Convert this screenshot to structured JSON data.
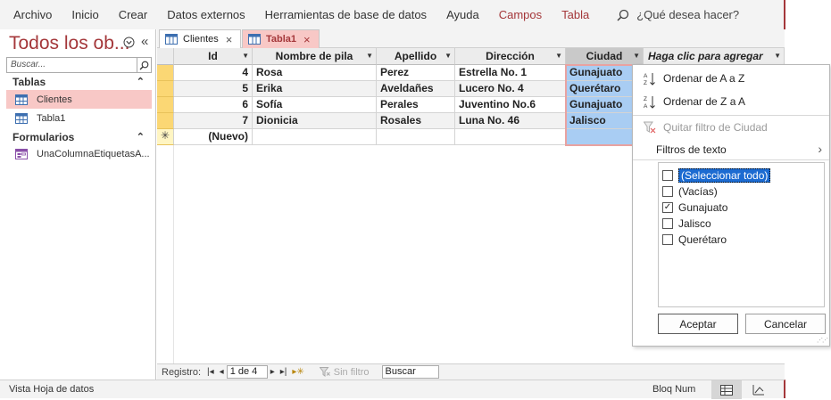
{
  "ribbon": {
    "tabs": [
      {
        "label": "Archivo",
        "contextual": false
      },
      {
        "label": "Inicio",
        "contextual": false
      },
      {
        "label": "Crear",
        "contextual": false
      },
      {
        "label": "Datos externos",
        "contextual": false
      },
      {
        "label": "Herramientas de base de datos",
        "contextual": false
      },
      {
        "label": "Ayuda",
        "contextual": false
      },
      {
        "label": "Campos",
        "contextual": true
      },
      {
        "label": "Tabla",
        "contextual": true
      }
    ],
    "tell_me": "¿Qué desea hacer?"
  },
  "nav": {
    "title": "Todos los ob...",
    "search_placeholder": "Buscar...",
    "groups": [
      {
        "label": "Tablas",
        "items": [
          {
            "label": "Clientes",
            "selected": true,
            "icon": "table-icon"
          },
          {
            "label": "Tabla1",
            "selected": false,
            "icon": "table-icon"
          }
        ]
      },
      {
        "label": "Formularios",
        "items": [
          {
            "label": "UnaColumnaEtiquetasA...",
            "selected": false,
            "icon": "form-icon"
          }
        ]
      }
    ]
  },
  "doc_tabs": [
    {
      "label": "Clientes",
      "active": false
    },
    {
      "label": "Tabla1",
      "active": true
    }
  ],
  "datasheet": {
    "columns": [
      "Id",
      "Nombre de pila",
      "Apellido",
      "Dirección",
      "Ciudad",
      "Haga clic para agregar"
    ],
    "rows": [
      {
        "id": "4",
        "nombre": "Rosa",
        "apellido": "Perez",
        "direccion": "Estrella No. 1",
        "ciudad": "Gunajuato"
      },
      {
        "id": "5",
        "nombre": "Erika",
        "apellido": "Aveldañes",
        "direccion": "Lucero No. 4",
        "ciudad": "Querétaro"
      },
      {
        "id": "6",
        "nombre": "Sofía",
        "apellido": "Perales",
        "direccion": "Juventino No.6",
        "ciudad": "Gunajuato"
      },
      {
        "id": "7",
        "nombre": "Dionicia",
        "apellido": "Rosales",
        "direccion": "Luna No. 46",
        "ciudad": "Jalisco"
      }
    ],
    "new_row_label": "(Nuevo)"
  },
  "record_bar": {
    "label": "Registro:",
    "current": "1 de 4",
    "no_filter": "Sin filtro",
    "search": "Buscar"
  },
  "filter_menu": {
    "sort_asc": "Ordenar de A a Z",
    "sort_desc": "Ordenar de Z a A",
    "clear_filter": "Quitar filtro de Ciudad",
    "text_filters": "Filtros de texto",
    "options": [
      {
        "label": "(Seleccionar todo)",
        "checked": false,
        "highlighted": true
      },
      {
        "label": "(Vacías)",
        "checked": false,
        "highlighted": false
      },
      {
        "label": "Gunajuato",
        "checked": true,
        "highlighted": false
      },
      {
        "label": "Jalisco",
        "checked": false,
        "highlighted": false
      },
      {
        "label": "Querétaro",
        "checked": false,
        "highlighted": false
      }
    ],
    "ok": "Aceptar",
    "cancel": "Cancelar"
  },
  "status": {
    "mode": "Vista Hoja de datos",
    "num_lock": "Bloq Num"
  },
  "colors": {
    "accent": "#a4373a",
    "selected_tab": "#f8c8c6",
    "filtered_column": "#a9cdf3",
    "record_selector": "#fbd774"
  }
}
